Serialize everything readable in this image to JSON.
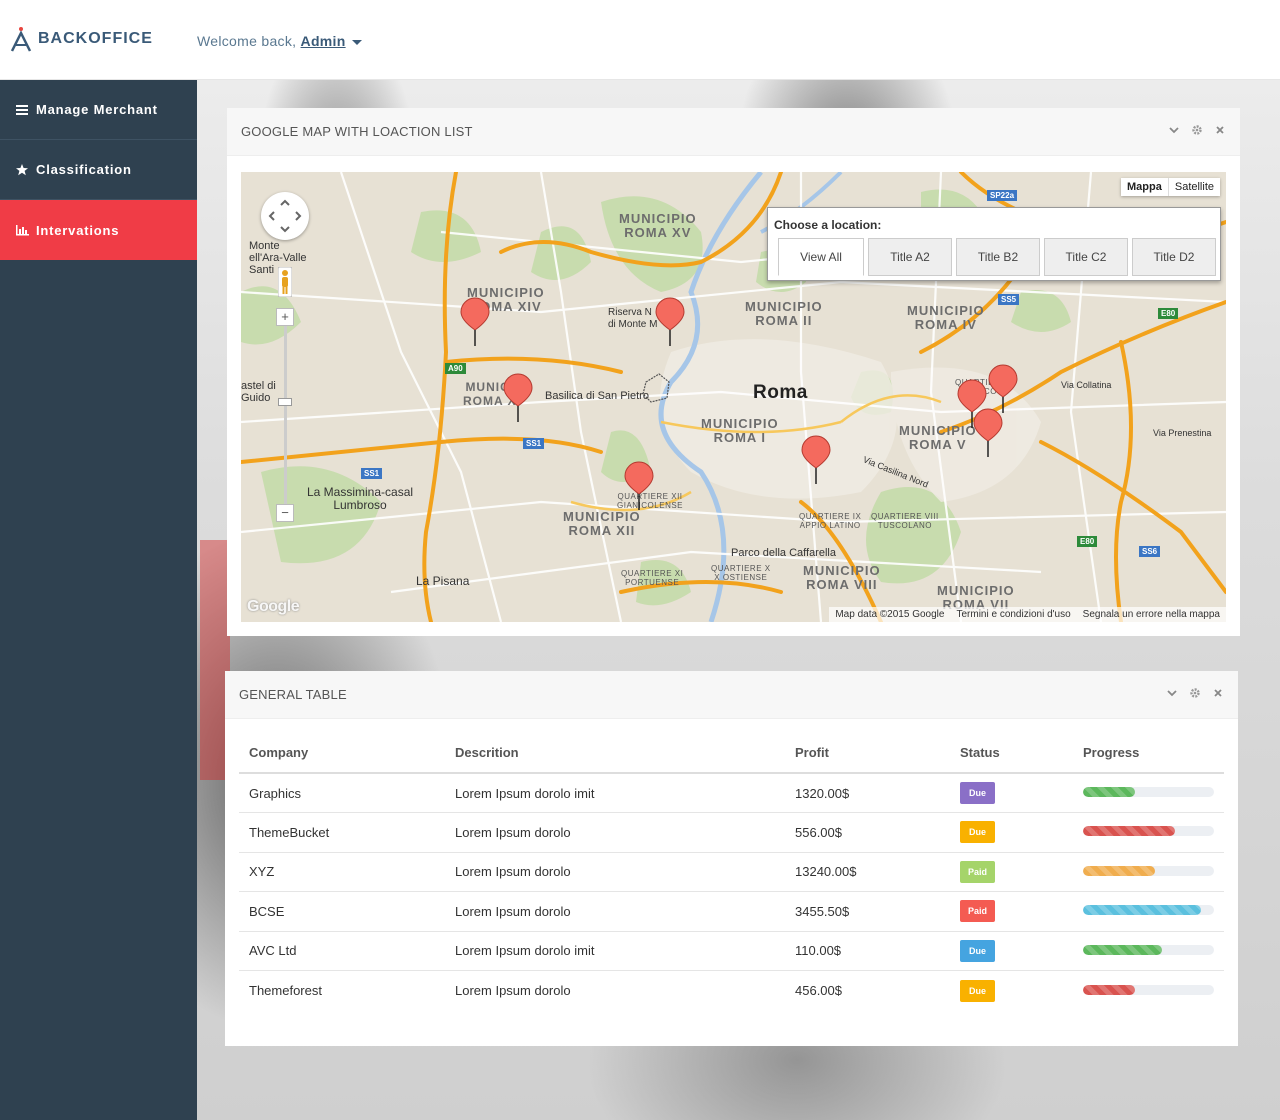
{
  "header": {
    "logo_text": "BACKOFFICE",
    "welcome_prefix": "Welcome back,",
    "user_name": "Admin"
  },
  "sidebar": {
    "items": [
      {
        "label": "Manage Merchant",
        "icon": "bars-icon",
        "active": false
      },
      {
        "label": "Classification",
        "icon": "star-icon",
        "active": false
      },
      {
        "label": "Intervations",
        "icon": "bar-chart-icon",
        "active": true
      }
    ]
  },
  "map_panel": {
    "title": "GOOGLE MAP WITH LOACTION LIST",
    "map_type": {
      "map": "Mappa",
      "satellite": "Satellite"
    },
    "location_box": {
      "title": "Choose a location:",
      "tabs": [
        "View All",
        "Title A2",
        "Title B2",
        "Title C2",
        "Title D2"
      ]
    },
    "labels": {
      "roma": "Roma",
      "monte_ara": "Monte\nell'Ara-Valle\nSanti",
      "castel_guido": "astel di\nGuido",
      "la_massimina": "La Massimina-casal\nLumbroso",
      "la_pisana": "La Pisana",
      "basilica": "Basilica di San Pietro",
      "riserva": "Riserva N\ndi Monte M",
      "parco": "Parco della Caffarella",
      "via_collatina": "Via Collatina",
      "via_prenestina": "Via Prenestina",
      "via_casilina": "Via Casilina Nord",
      "muni_xv": "MUNICIPIO\nROMA XV",
      "muni_xiv": "MUNICIPIO\nROMA XIV",
      "muni_ii": "MUNICIPIO\nROMA II",
      "muni_iv": "MUNICIPIO\nROMA IV",
      "muni_i": "MUNICIPIO\nROMA I",
      "muni_v": "MUNICIPIO\nROMA V",
      "muni_xii": "MUNICIPIO\nROMA XII",
      "muni_viii": "MUNICIPIO\nROMA VIII",
      "muni_vii": "MUNICIPIO\nROMA VII",
      "muni_xiii": "MUNICI\nROMA X",
      "q_appio": "QUARTIERE IX\nAPPIO LATINO",
      "q_tuscolano": "QUARTIERE VIII\nTUSCOLANO",
      "q_portuense": "QUARTIERE XI\nPORTUENSE",
      "q_ostiense": "QUARTIERE X\nX OSTIENSE",
      "q_gianicolense": "QUARTIERE XII\nGIANICOLENSE",
      "q_xxii": "QUARTIERE\nXXII CO",
      "road_a90": "A90",
      "road_ss1a": "SS1",
      "road_ss1b": "SS1",
      "road_ss5": "SS5",
      "road_e80a": "E80",
      "road_e80b": "E80",
      "road_ss6": "SS6",
      "road_sp22a": "SP22a",
      "google": "Google"
    },
    "footer": [
      "Map data ©2015 Google",
      "Termini e condizioni d'uso",
      "Segnala un errore nella mappa"
    ]
  },
  "table_panel": {
    "title": "GENERAL TABLE",
    "columns": [
      "Company",
      "Descrition",
      "Profit",
      "Status",
      "Progress"
    ],
    "rows": [
      {
        "company": "Graphics",
        "description": "Lorem Ipsum dorolo imit",
        "profit": "1320.00$",
        "status": "Due",
        "status_color": "#8a6fc7",
        "progress": 0.4,
        "progress_color": "#5cb85c"
      },
      {
        "company": "ThemeBucket",
        "description": "Lorem Ipsum dorolo",
        "profit": "556.00$",
        "status": "Due",
        "status_color": "#f9b100",
        "progress": 0.7,
        "progress_color": "#d9534f"
      },
      {
        "company": "XYZ",
        "description": "Lorem Ipsum dorolo",
        "profit": "13240.00$",
        "status": "Paid",
        "status_color": "#a5d46a",
        "progress": 0.55,
        "progress_color": "#f0ad4e"
      },
      {
        "company": "BCSE",
        "description": "Lorem Ipsum dorolo",
        "profit": "3455.50$",
        "status": "Paid",
        "status_color": "#f45b52",
        "progress": 0.9,
        "progress_color": "#5bc0de"
      },
      {
        "company": "AVC Ltd",
        "description": "Lorem Ipsum dorolo imit",
        "profit": "110.00$",
        "status": "Due",
        "status_color": "#45a4e0",
        "progress": 0.6,
        "progress_color": "#5cb85c"
      },
      {
        "company": "Themeforest",
        "description": "Lorem Ipsum dorolo",
        "profit": "456.00$",
        "status": "Due",
        "status_color": "#f9b100",
        "progress": 0.4,
        "progress_color": "#d9534f"
      }
    ]
  },
  "colors": {
    "sidebar_bg": "#2f4150",
    "active_red": "#f03c46",
    "brand_blue": "#3a5a78",
    "marker": "#f46a5e"
  }
}
